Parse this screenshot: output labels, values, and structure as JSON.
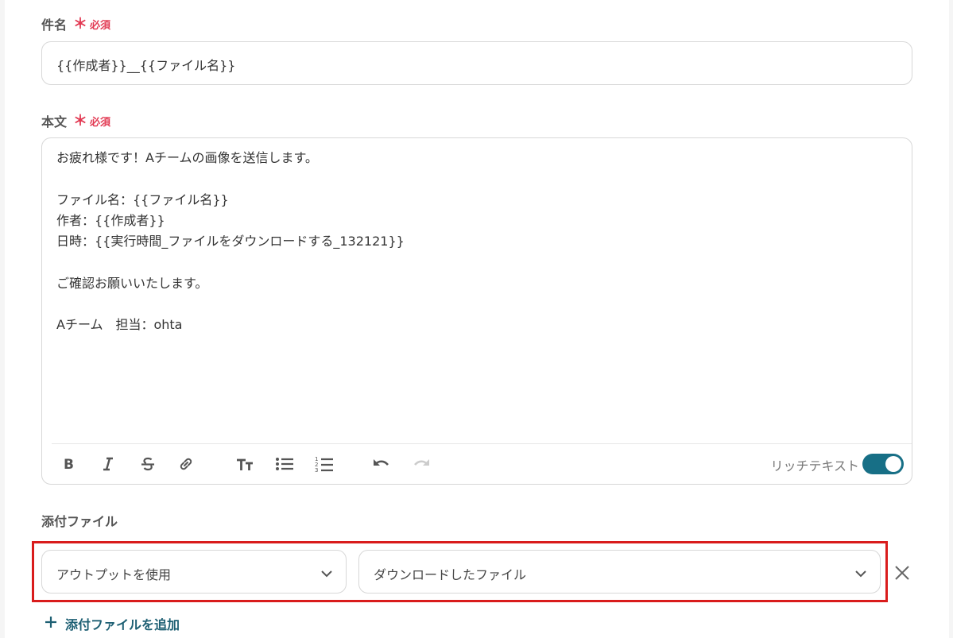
{
  "subject": {
    "label": "件名",
    "required_mark": "＊",
    "required_text": "必須",
    "value": "{{作成者}}__{{ファイル名}}"
  },
  "body": {
    "label": "本文",
    "required_mark": "＊",
    "required_text": "必須",
    "lines": [
      "お疲れ様です！Aチームの画像を送信します。",
      "",
      "ファイル名：{{ファイル名}}",
      "作者：{{作成者}}",
      "日時：{{実行時間_ファイルをダウンロードする_132121}}",
      "",
      "ご確認お願いいたします。",
      "",
      "Aチーム　担当：ohta"
    ],
    "rich_text_label": "リッチテキスト",
    "rich_text_enabled": true
  },
  "toolbar_icons": [
    "bold-icon",
    "italic-icon",
    "strikethrough-icon",
    "link-icon",
    "text-size-icon",
    "bullet-list-icon",
    "numbered-list-icon",
    "undo-icon",
    "redo-icon"
  ],
  "attachment": {
    "label": "添付ファイル",
    "source_select": "アウトプットを使用",
    "value_select": "ダウンロードしたファイル",
    "add_label": "添付ファイルを追加"
  },
  "colors": {
    "accent": "#176f86",
    "required": "#e23a53",
    "highlight_border": "#d91c1c",
    "link": "#1d5f73"
  }
}
